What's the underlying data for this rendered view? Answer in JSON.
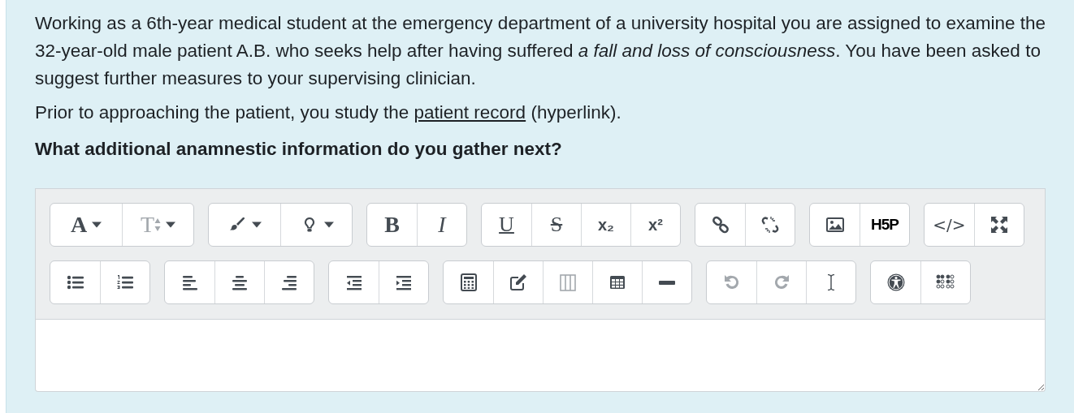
{
  "question": {
    "intro": "Working as a 6th-year medical student at the emergency department of a university hospital you are assigned to examine the 32-year-old male patient A.B. who seeks help after having suffered *a fall and loss of consciousness*. You have been asked to suggest further measures to your supervising clinician.",
    "record": {
      "before": "Prior to approaching the patient, you study the ",
      "link": "patient record",
      "after": " (hyperlink)."
    },
    "prompt": "What additional anamnestic information do you gather next?"
  },
  "editor": {
    "toolbar": [
      [
        [
          {
            "kind": "font",
            "label": "A",
            "dropdown": true,
            "disabled": false
          },
          {
            "kind": "size",
            "label": "T",
            "dropdown": true,
            "disabled": true
          }
        ],
        [
          {
            "kind": "color",
            "dropdown": true,
            "disabled": false
          },
          {
            "kind": "highlight",
            "dropdown": true,
            "disabled": false
          }
        ],
        [
          {
            "kind": "bold",
            "label": "B",
            "disabled": false
          },
          {
            "kind": "italic",
            "label": "I",
            "disabled": false
          }
        ],
        [
          {
            "kind": "underline",
            "label": "U",
            "disabled": false
          },
          {
            "kind": "strike",
            "label": "S",
            "disabled": false
          },
          {
            "kind": "subscript",
            "label": "x₂",
            "disabled": false
          },
          {
            "kind": "superscript",
            "label": "x²",
            "disabled": false
          }
        ],
        [
          {
            "kind": "link",
            "disabled": false
          },
          {
            "kind": "unlink",
            "disabled": false
          }
        ],
        [
          {
            "kind": "image",
            "disabled": false
          },
          {
            "kind": "h5p",
            "label": "H5P",
            "disabled": false
          }
        ],
        [
          {
            "kind": "html",
            "label": "</>",
            "disabled": false
          },
          {
            "kind": "fullscreen",
            "disabled": false
          }
        ]
      ],
      [
        [
          {
            "kind": "bullets",
            "disabled": false
          },
          {
            "kind": "numbers",
            "disabled": false
          }
        ],
        [
          {
            "kind": "alignleft",
            "disabled": false
          },
          {
            "kind": "aligncenter",
            "disabled": false
          },
          {
            "kind": "alignright",
            "disabled": false
          }
        ],
        [
          {
            "kind": "outdent",
            "disabled": false
          },
          {
            "kind": "indent",
            "disabled": false
          }
        ],
        [
          {
            "kind": "equation",
            "disabled": false
          },
          {
            "kind": "edit",
            "disabled": false
          },
          {
            "kind": "columns",
            "disabled": true
          },
          {
            "kind": "table",
            "disabled": false
          },
          {
            "kind": "rule",
            "disabled": false
          }
        ],
        [
          {
            "kind": "undo",
            "disabled": true
          },
          {
            "kind": "redo",
            "disabled": true
          },
          {
            "kind": "cursor",
            "disabled": false
          }
        ],
        [
          {
            "kind": "accessibility",
            "disabled": false
          },
          {
            "kind": "braille",
            "disabled": false
          }
        ]
      ]
    ]
  }
}
